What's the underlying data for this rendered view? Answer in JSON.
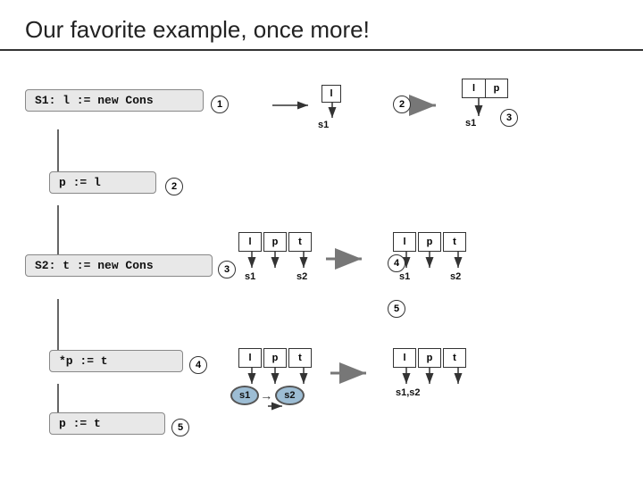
{
  "title": "Our favorite example, once more!",
  "steps": [
    {
      "id": 1,
      "code": "S1: l := new Cons"
    },
    {
      "id": 2,
      "code": "p := l"
    },
    {
      "id": 3,
      "code": "S2: t := new Cons"
    },
    {
      "id": 4,
      "code": "*p := t"
    },
    {
      "id": 5,
      "code": "p := t"
    }
  ],
  "labels": {
    "l": "l",
    "p": "p",
    "t": "t",
    "s1": "s1",
    "s2": "s2",
    "s1s2": "s1,s2"
  }
}
